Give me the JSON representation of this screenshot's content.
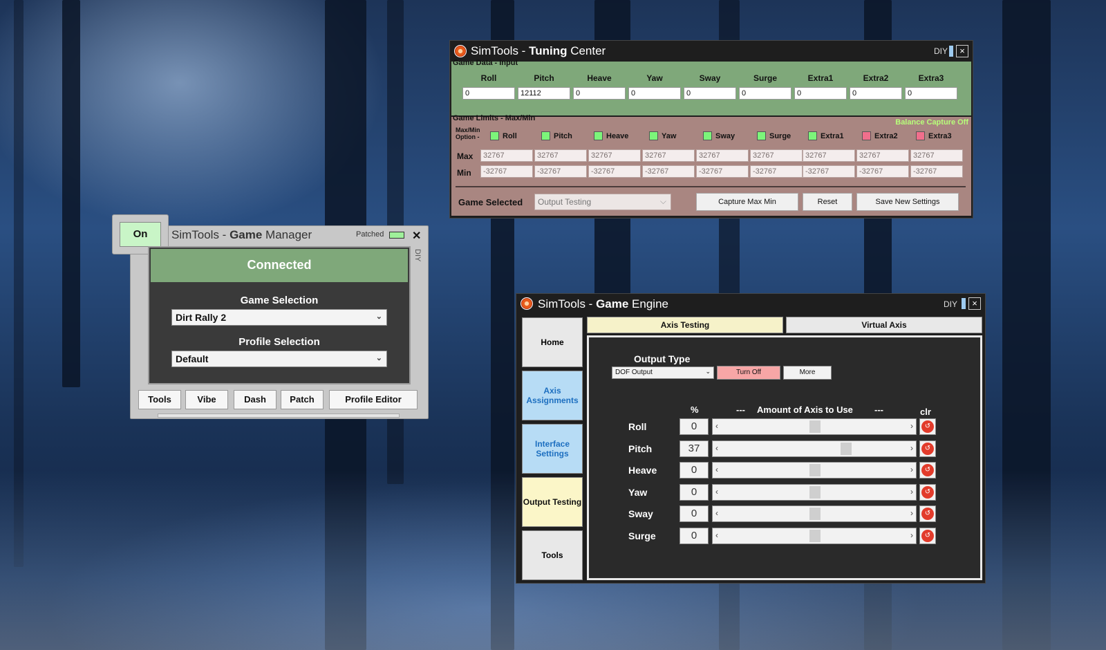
{
  "tuning_center": {
    "title_prefix": "SimTools - ",
    "title_bold": "Tuning",
    "title_suffix": " Center",
    "diy": "DIY",
    "close": "×",
    "input_section": "Game Data - Input",
    "axes": [
      "Roll",
      "Pitch",
      "Heave",
      "Yaw",
      "Sway",
      "Surge",
      "Extra1",
      "Extra2",
      "Extra3"
    ],
    "input_values": [
      "0",
      "12112",
      "0",
      "0",
      "0",
      "0",
      "0",
      "0",
      "0"
    ],
    "limits_section": "Game Limits - Max/Min",
    "balance_capture": "Balance Capture Off",
    "maxmin_option_line1": "Max/Min",
    "maxmin_option_line2": "Option -",
    "checkboxes": [
      {
        "label": "Roll",
        "color": "#7cf57a"
      },
      {
        "label": "Pitch",
        "color": "#7cf57a"
      },
      {
        "label": "Heave",
        "color": "#7cf57a"
      },
      {
        "label": "Yaw",
        "color": "#7cf57a"
      },
      {
        "label": "Sway",
        "color": "#7cf57a"
      },
      {
        "label": "Surge",
        "color": "#7cf57a"
      },
      {
        "label": "Extra1",
        "color": "#7cf57a"
      },
      {
        "label": "Extra2",
        "color": "#f06f8c"
      },
      {
        "label": "Extra3",
        "color": "#f06f8c"
      }
    ],
    "max_label": "Max",
    "min_label": "Min",
    "max_values": [
      "32767",
      "32767",
      "32767",
      "32767",
      "32767",
      "32767",
      "32767",
      "32767",
      "32767"
    ],
    "min_values": [
      "-32767",
      "-32767",
      "-32767",
      "-32767",
      "-32767",
      "-32767",
      "-32767",
      "-32767",
      "-32767"
    ],
    "game_selected_label": "Game Selected",
    "game_selected_value": "Output Testing",
    "capture_button": "Capture Max Min",
    "reset_button": "Reset",
    "save_button": "Save New Settings"
  },
  "game_manager": {
    "on_button": "On",
    "title_prefix": "SimTools - ",
    "title_bold": "Game",
    "title_suffix": " Manager",
    "patched": "Patched",
    "close": "✕",
    "diy": "DIY",
    "status": "Connected",
    "game_selection_label": "Game Selection",
    "game_selection_value": "Dirt Rally 2",
    "profile_selection_label": "Profile Selection",
    "profile_selection_value": "Default",
    "buttons": [
      "Tools",
      "Vibe",
      "Dash",
      "Patch",
      "Profile Editor"
    ]
  },
  "game_engine": {
    "title_prefix": "SimTools - ",
    "title_bold": "Game",
    "title_suffix": " Engine",
    "diy": "DIY",
    "close": "×",
    "nav": [
      {
        "label": "Home",
        "color": "#e8e8e8"
      },
      {
        "label": "Axis Assignments",
        "color": "#b7dcf5"
      },
      {
        "label": "Interface Settings",
        "color": "#b7dcf5"
      },
      {
        "label": "Output Testing",
        "color": "#fbf6c8"
      },
      {
        "label": "Tools",
        "color": "#e8e8e8"
      }
    ],
    "tabs": [
      {
        "label": "Axis Testing",
        "color": "#f6f2c9"
      },
      {
        "label": "Virtual Axis",
        "color": "#e8e8e8"
      }
    ],
    "output_type_label": "Output Type",
    "output_type_value": "DOF Output",
    "turn_off_button": "Turn Off",
    "more_button": "More",
    "percent_header": "%",
    "amount_header": "Amount of Axis to Use",
    "dashes": "---",
    "clr_header": "clr",
    "axes": [
      {
        "name": "Roll",
        "value": "0",
        "level": 0.5
      },
      {
        "name": "Pitch",
        "value": "37",
        "level": 0.68
      },
      {
        "name": "Heave",
        "value": "0",
        "level": 0.5
      },
      {
        "name": "Yaw",
        "value": "0",
        "level": 0.5
      },
      {
        "name": "Sway",
        "value": "0",
        "level": 0.5
      },
      {
        "name": "Surge",
        "value": "0",
        "level": 0.5
      }
    ]
  }
}
